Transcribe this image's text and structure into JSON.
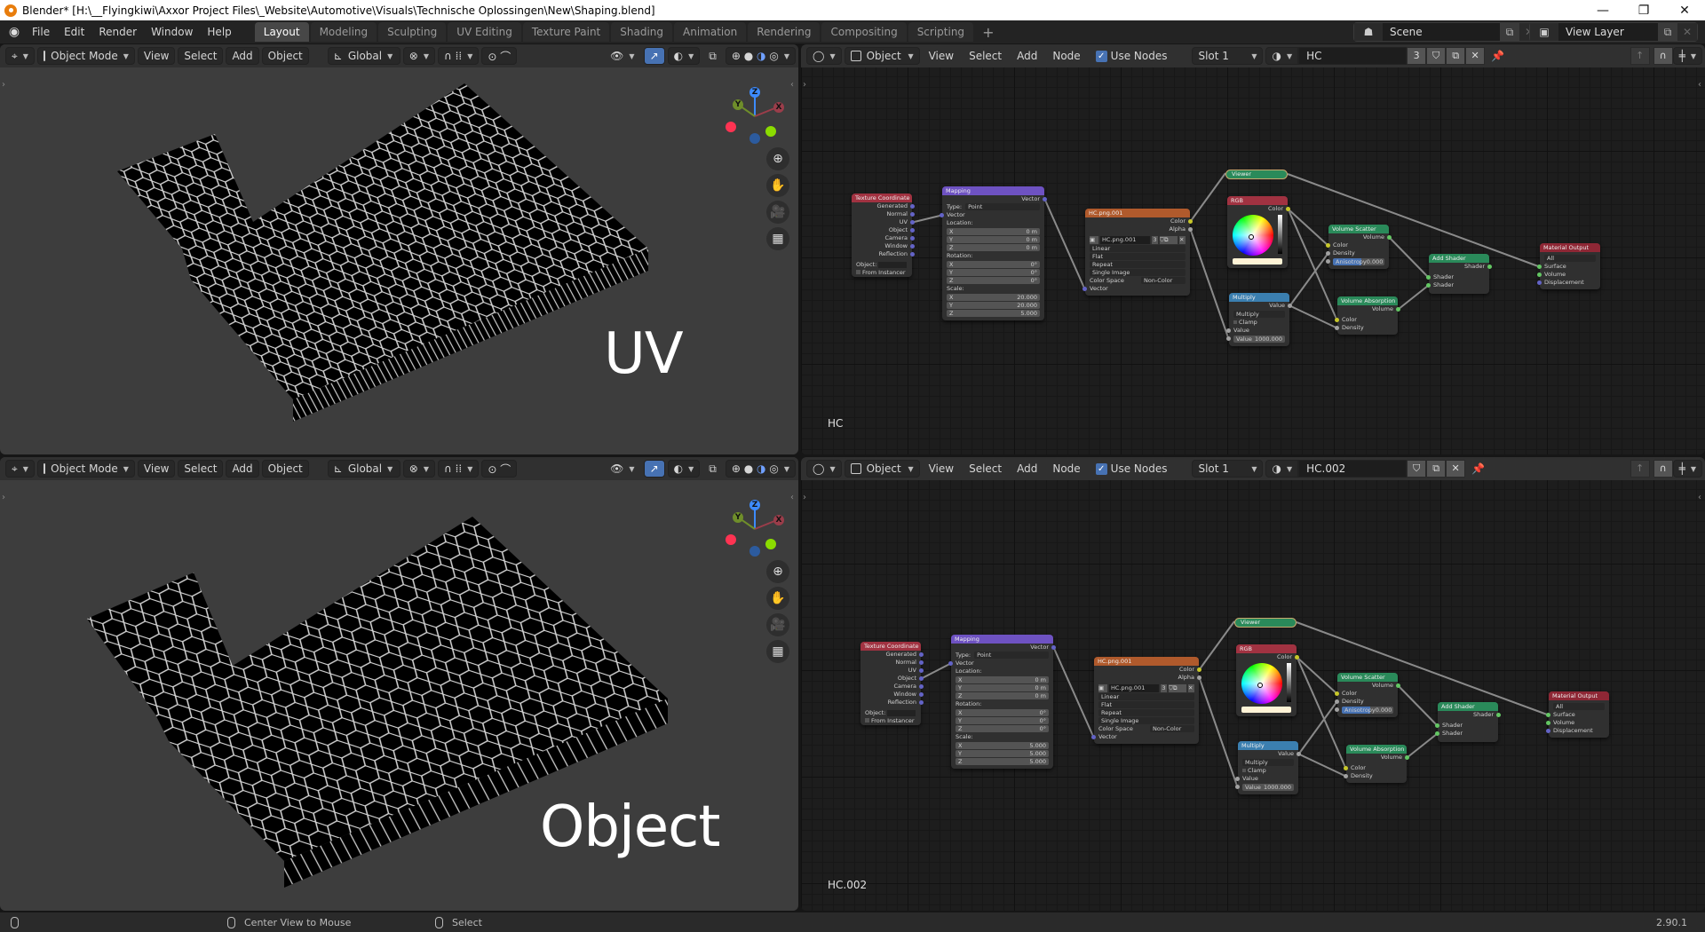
{
  "window": {
    "title": "Blender* [H:\\__Flyingkiwi\\Axxor Project Files\\_Website\\Automotive\\Visuals\\Technische Oplossingen\\New\\Shaping.blend]",
    "minimize": "—",
    "maximize": "❐",
    "close": "✕"
  },
  "menu": [
    "File",
    "Edit",
    "Render",
    "Window",
    "Help"
  ],
  "workspaces": [
    "Layout",
    "Modeling",
    "Sculpting",
    "UV Editing",
    "Texture Paint",
    "Shading",
    "Animation",
    "Rendering",
    "Compositing",
    "Scripting"
  ],
  "active_workspace": "Layout",
  "add_workspace": "+",
  "scene": {
    "label": "Scene",
    "view_layer": "View Layer"
  },
  "viewport_header": {
    "mode": "Object Mode",
    "menus": [
      "View",
      "Select",
      "Add",
      "Object"
    ],
    "orientation": "Global"
  },
  "viewports": [
    {
      "overlay_text": "UV"
    },
    {
      "overlay_text": "Object"
    }
  ],
  "gizmo": {
    "x": "X",
    "y": "Y",
    "z": "Z"
  },
  "node_header": {
    "object_type": "Object",
    "menus": [
      "View",
      "Select",
      "Add",
      "Node"
    ],
    "use_nodes_label": "Use Nodes",
    "use_nodes_checked": true,
    "slot": "Slot 1"
  },
  "node_editors": [
    {
      "material": "HC",
      "users": "3",
      "label": "HC",
      "texcoord_link": "UV",
      "mapping_scale": [
        "20.000",
        "20.000",
        "5.000"
      ]
    },
    {
      "material": "HC.002",
      "users": "",
      "label": "HC.002",
      "texcoord_link": "Object",
      "mapping_scale": [
        "5.000",
        "5.000",
        "5.000"
      ]
    }
  ],
  "nodes": {
    "texcoord": {
      "title": "Texture Coordinate",
      "outputs": [
        "Generated",
        "Normal",
        "UV",
        "Object",
        "Camera",
        "Window",
        "Reflection"
      ],
      "object_label": "Object:",
      "from_instancer": "From Instancer"
    },
    "mapping": {
      "title": "Mapping",
      "output": "Vector",
      "type_label": "Type:",
      "type": "Point",
      "vector_in": "Vector",
      "location_label": "Location:",
      "location": [
        "0 m",
        "0 m",
        "0 m"
      ],
      "rotation_label": "Rotation:",
      "rotation": [
        "0°",
        "0°",
        "0°"
      ],
      "scale_label": "Scale:",
      "axes": [
        "X",
        "Y",
        "Z"
      ]
    },
    "image": {
      "title": "HC.png.001",
      "outputs": [
        "Color",
        "Alpha"
      ],
      "image_name": "HC.png.001",
      "users": "3",
      "interpolation": "Linear",
      "projection": "Flat",
      "extension": "Repeat",
      "source": "Single Image",
      "color_space_label": "Color Space",
      "color_space": "Non-Color",
      "vector_in": "Vector"
    },
    "viewer": {
      "title": "Viewer"
    },
    "rgb": {
      "title": "RGB",
      "output": "Color",
      "swatch": "#fff3d6"
    },
    "multiply": {
      "title": "Multiply",
      "output": "Value",
      "operation": "Multiply",
      "clamp": "Clamp",
      "value_in": "Value",
      "value_label": "Value",
      "value": "1000.000"
    },
    "vscatter": {
      "title": "Volume Scatter",
      "output": "Volume",
      "inputs": [
        "Color",
        "Density"
      ],
      "anisotropy_label": "Anisotropy",
      "anisotropy": "0.000"
    },
    "vabsorb": {
      "title": "Volume Absorption",
      "output": "Volume",
      "inputs": [
        "Color",
        "Density"
      ]
    },
    "addshader": {
      "title": "Add Shader",
      "output": "Shader",
      "inputs": [
        "Shader",
        "Shader"
      ]
    },
    "matout": {
      "title": "Material Output",
      "target": "All",
      "inputs": [
        "Surface",
        "Volume",
        "Displacement"
      ]
    }
  },
  "statusbar": {
    "left_hint": "",
    "middle_hint": "Center View to Mouse",
    "right_hint": "Select",
    "version": "2.90.1"
  }
}
